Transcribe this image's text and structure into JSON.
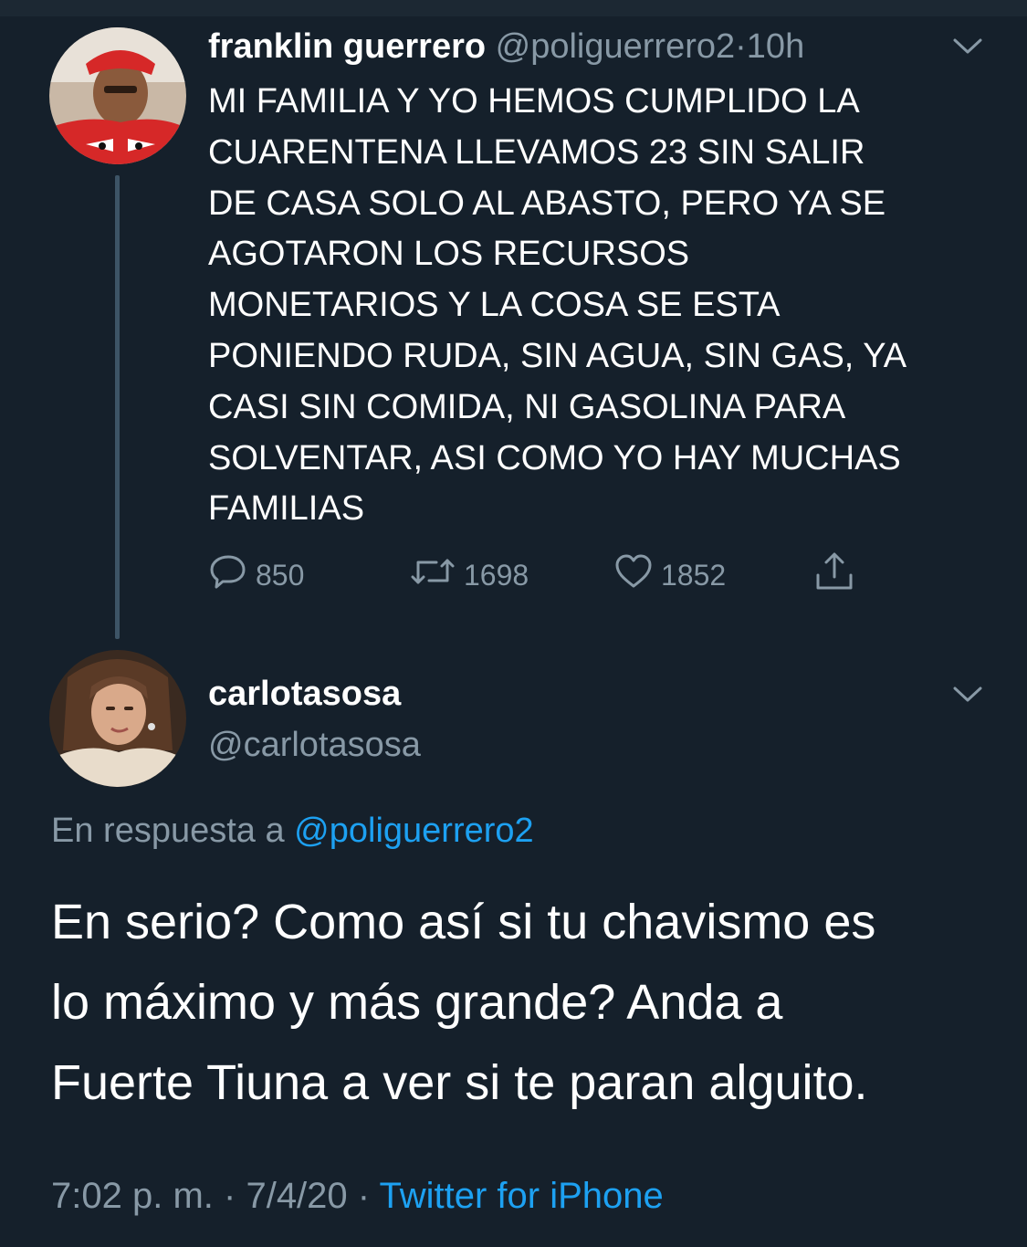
{
  "colors": {
    "background": "#15202b",
    "muted_text": "#8899a6",
    "link": "#1da1f2",
    "thread_line": "#3d5466"
  },
  "tweet1": {
    "display_name": "franklin guerrero",
    "handle": "@poliguerrero2",
    "separator": "·",
    "time": "10h",
    "text": "MI FAMILIA Y YO HEMOS CUMPLIDO LA\nCUARENTENA LLEVAMOS 23 SIN SALIR\nDE CASA  SOLO AL ABASTO, PERO YA SE\nAGOTARON LOS RECURSOS\nMONETARIOS Y LA COSA SE ESTA\nPONIENDO RUDA, SIN AGUA, SIN GAS, YA\nCASI SIN COMIDA, NI GASOLINA PARA\nSOLVENTAR, ASI COMO YO HAY MUCHAS\nFAMILIAS",
    "replies": "850",
    "retweets": "1698",
    "likes": "1852",
    "icons": [
      "reply-icon",
      "retweet-icon",
      "like-icon",
      "share-icon",
      "chevron-down-icon"
    ]
  },
  "tweet2": {
    "display_name": "carlotasosa",
    "handle": "@carlotasosa",
    "reply_prefix": "En respuesta a",
    "reply_handle": "@poliguerrero2",
    "text": "En serio? Como así si tu chavismo es\nlo máximo y más grande? Anda a\nFuerte Tiuna a ver si te paran alguito.",
    "time": "7:02 p. m.",
    "separator": "·",
    "date": "7/4/20",
    "source": "Twitter for iPhone"
  }
}
